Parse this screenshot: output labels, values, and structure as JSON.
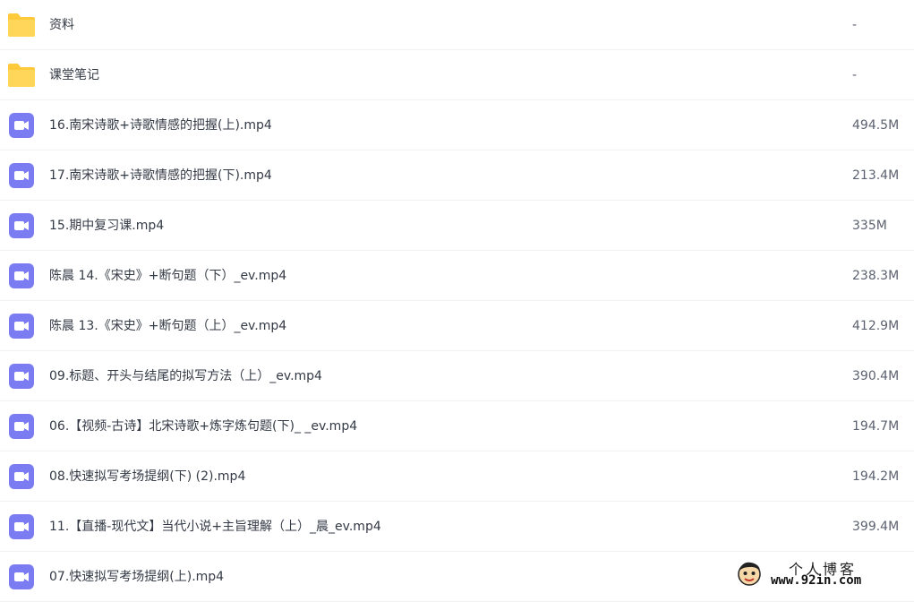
{
  "files": [
    {
      "type": "folder",
      "name": "资料",
      "size": "-"
    },
    {
      "type": "folder",
      "name": "课堂笔记",
      "size": "-"
    },
    {
      "type": "video",
      "name": "16.南宋诗歌+诗歌情感的把握(上).mp4",
      "size": "494.5M"
    },
    {
      "type": "video",
      "name": "17.南宋诗歌+诗歌情感的把握(下).mp4",
      "size": "213.4M"
    },
    {
      "type": "video",
      "name": "15.期中复习课.mp4",
      "size": "335M"
    },
    {
      "type": "video",
      "name": "陈晨 14.《宋史》+断句题（下）_ev.mp4",
      "size": "238.3M"
    },
    {
      "type": "video",
      "name": "陈晨 13.《宋史》+断句题（上）_ev.mp4",
      "size": "412.9M"
    },
    {
      "type": "video",
      "name": "09.标题、开头与结尾的拟写方法（上）_ev.mp4",
      "size": "390.4M"
    },
    {
      "type": "video",
      "name": "06.【视频-古诗】北宋诗歌+炼字炼句题(下)_ _ev.mp4",
      "size": "194.7M"
    },
    {
      "type": "video",
      "name": "08.快速拟写考场提纲(下) (2).mp4",
      "size": "194.2M"
    },
    {
      "type": "video",
      "name": "11.【直播-现代文】当代小说+主旨理解（上）_晨_ev.mp4",
      "size": "399.4M"
    },
    {
      "type": "video",
      "name": "07.快速拟写考场提纲(上).mp4",
      "size": ""
    }
  ],
  "icons": {
    "folder": "folder-icon",
    "video": "video-file-icon"
  },
  "colors": {
    "folder": "#ffc93c",
    "video": "#7b7cf2",
    "text": "#333a45",
    "size": "#5c6270"
  },
  "watermark": {
    "title": "个人博客",
    "url": "www.92in.com"
  }
}
